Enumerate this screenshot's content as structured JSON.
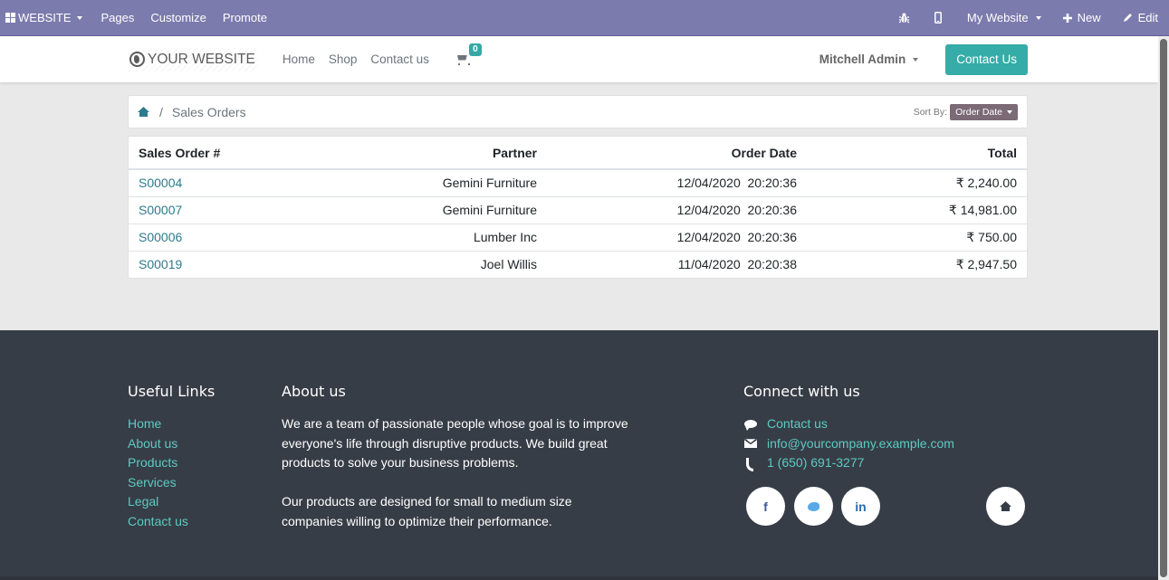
{
  "adminbar": {
    "app_menu": "WEBSITE",
    "menu_items": [
      "Pages",
      "Customize",
      "Promote"
    ],
    "website_selector": "My Website",
    "new_label": "New",
    "edit_label": "Edit",
    "colors": {
      "background": "#7c7bad"
    }
  },
  "navbar": {
    "logo_text": "YOUR WEBSITE",
    "links": [
      "Home",
      "Shop",
      "Contact us"
    ],
    "cart_count": "0",
    "user_name": "Mitchell Admin",
    "cta_label": "Contact Us",
    "colors": {
      "cta": "#35aca7"
    }
  },
  "breadcrumb": {
    "separator": "/",
    "current": "Sales Orders",
    "sort_label": "Sort By:",
    "sort_value": "Order Date"
  },
  "orders": {
    "columns": [
      "Sales Order #",
      "Partner",
      "Order Date",
      "Total"
    ],
    "rows": [
      {
        "number": "S00004",
        "partner": "Gemini Furniture",
        "date": "12/04/2020  20:20:36",
        "total": "₹ 2,240.00"
      },
      {
        "number": "S00007",
        "partner": "Gemini Furniture",
        "date": "12/04/2020  20:20:36",
        "total": "₹ 14,981.00"
      },
      {
        "number": "S00006",
        "partner": "Lumber Inc",
        "date": "12/04/2020  20:20:36",
        "total": "₹ 750.00"
      },
      {
        "number": "S00019",
        "partner": "Joel Willis",
        "date": "11/04/2020  20:20:38",
        "total": "₹ 2,947.50"
      }
    ]
  },
  "footer": {
    "useful_links": {
      "title": "Useful Links",
      "items": [
        "Home",
        "About us",
        "Products",
        "Services",
        "Legal",
        "Contact us"
      ]
    },
    "about": {
      "title": "About us",
      "paragraphs": [
        "We are a team of passionate people whose goal is to improve everyone's life through disruptive products. We build great products to solve your business problems.",
        "Our products are designed for small to medium size companies willing to optimize their performance."
      ]
    },
    "connect": {
      "title": "Connect with us",
      "contact_label": "Contact us",
      "email": "info@yourcompany.example.com",
      "phone": "1 (650) 691-3277",
      "socials": [
        "facebook-icon",
        "twitter-icon",
        "linkedin-icon",
        "home-icon"
      ],
      "facebook_glyph": "f",
      "linkedin_glyph": "in"
    },
    "colors": {
      "background": "#373d46",
      "link": "#5ccac3"
    }
  }
}
